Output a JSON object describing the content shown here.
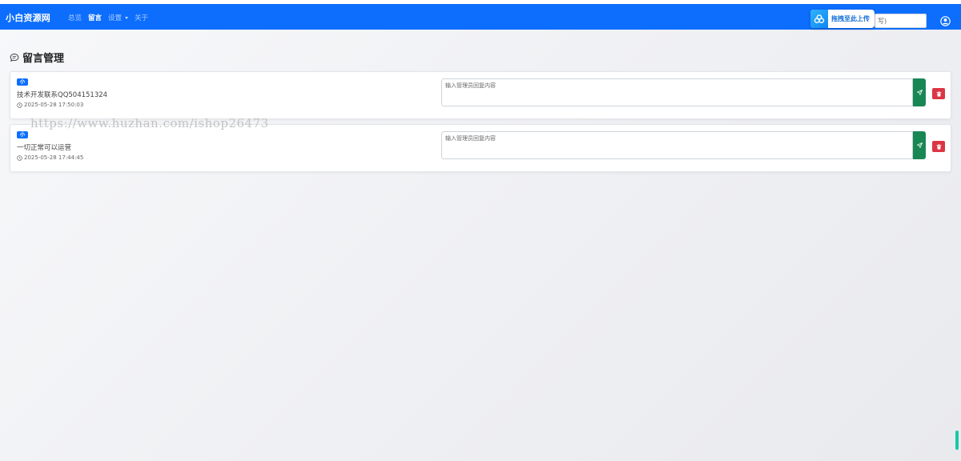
{
  "app": {
    "brand": "小白资源网"
  },
  "nav": {
    "items": [
      {
        "label": "总览",
        "active": false
      },
      {
        "label": "留言",
        "active": true
      },
      {
        "label": "设置",
        "active": false,
        "dropdown": true
      },
      {
        "label": "关于",
        "active": false
      }
    ]
  },
  "upload_badge": {
    "label": "拖拽至此上传"
  },
  "search": {
    "value": "写)"
  },
  "page": {
    "title": "留言管理"
  },
  "messages": [
    {
      "badge": "小",
      "content": "技术开发联系QQ504151324",
      "time": "2025-05-28 17:50:03",
      "reply_placeholder": "输入管理员回复内容"
    },
    {
      "badge": "小",
      "content": "一切正常可以运营",
      "time": "2025-05-28 17:44:45",
      "reply_placeholder": "输入管理员回复内容"
    }
  ],
  "watermark": {
    "text": "https://www.huzhan.com/ishop26473"
  },
  "colors": {
    "navbar": "#0d6efd",
    "send": "#198754",
    "delete": "#dc3545",
    "badge": "#0d6efd"
  }
}
